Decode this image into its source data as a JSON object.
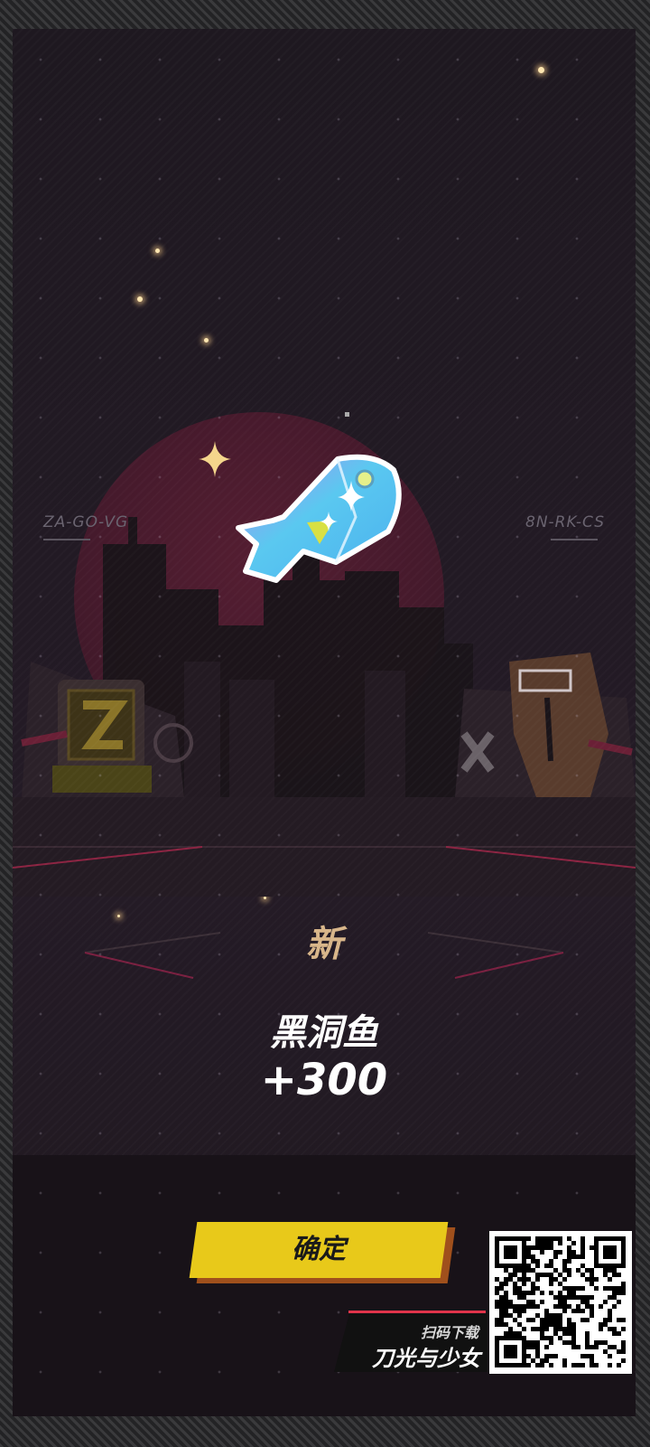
{
  "plates": {
    "left": "ZA-GO-VG",
    "right": "8N-RK-CS"
  },
  "reward": {
    "badge": "新",
    "item_name": "黑洞鱼",
    "quantity": "+300",
    "item_icon": "crystal-fish-icon"
  },
  "confirm_label": "确定",
  "promo": {
    "caption": "扫码下载",
    "game_title": "刀光与少女"
  },
  "colors": {
    "confirm_button": "#e8c91a",
    "badge_text": "#d8b68a",
    "accent_red": "#e0344a",
    "fish_body": "#5ac8f0"
  }
}
